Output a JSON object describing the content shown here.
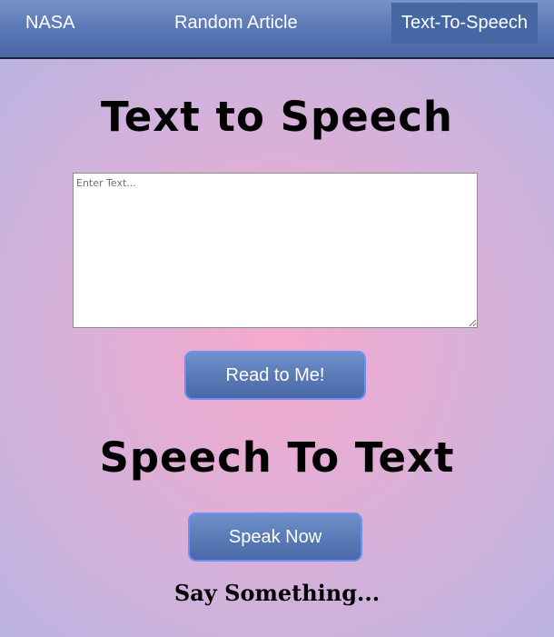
{
  "nav": {
    "items": [
      {
        "label": "NASA"
      },
      {
        "label": "Random Article"
      },
      {
        "label": "Text-To-Speech",
        "active": true
      }
    ]
  },
  "text_to_speech": {
    "heading": "Text to Speech",
    "textarea_placeholder": "Enter Text...",
    "textarea_value": "",
    "button_label": "Read to Me!"
  },
  "speech_to_text": {
    "heading": "Speech To Text",
    "button_label": "Speak Now",
    "output_text": "Say Something..."
  },
  "colors": {
    "nav_bg": "#5a78b4",
    "nav_active_bg": "#4568a5",
    "button_bg": "#5b7bb8",
    "button_border": "#6f8ff5",
    "background_center": "#f5a9cd",
    "background_edge": "#bdb3e1"
  }
}
